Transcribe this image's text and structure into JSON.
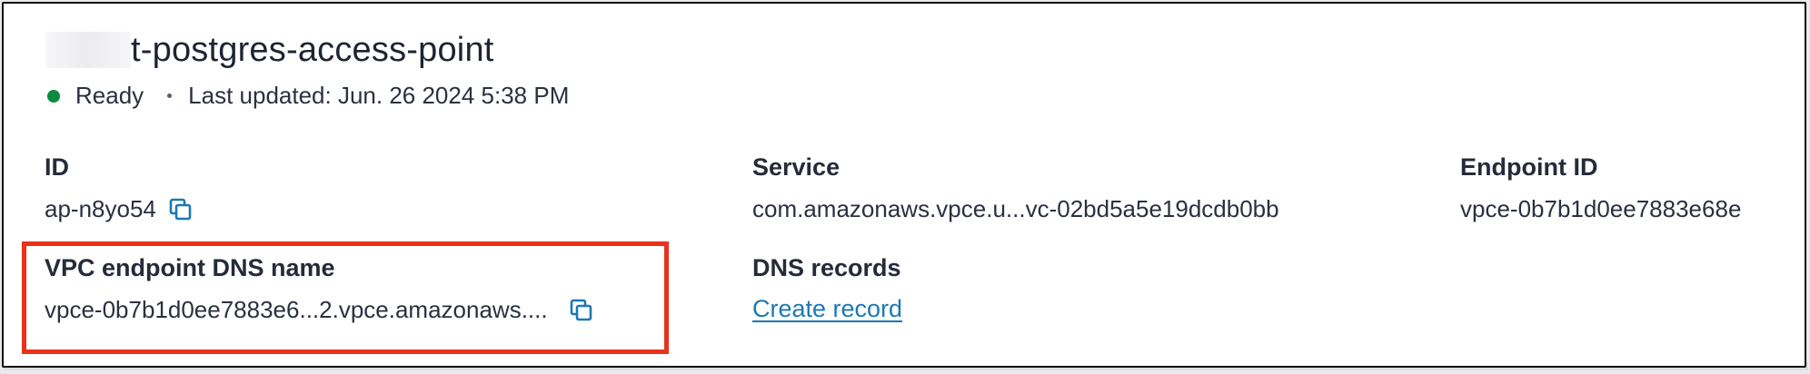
{
  "header": {
    "title": "t-postgres-access-point",
    "status": "Ready",
    "last_updated": "Last updated: Jun. 26 2024 5:38 PM"
  },
  "fields": {
    "id": {
      "label": "ID",
      "value": "ap-n8yo54"
    },
    "service": {
      "label": "Service",
      "value": "com.amazonaws.vpce.u...vc-02bd5a5e19dcdb0bb"
    },
    "endpoint_id": {
      "label": "Endpoint ID",
      "value": "vpce-0b7b1d0ee7883e68e"
    },
    "vpc_dns_name": {
      "label": "VPC endpoint DNS name",
      "value": "vpce-0b7b1d0ee7883e6...2.vpce.amazonaws...."
    },
    "dns_records": {
      "label": "DNS records",
      "link": "Create record"
    }
  },
  "colors": {
    "status_ready": "#0e8a3e",
    "link": "#1d78b4",
    "highlight": "#e8321c",
    "copy_icon": "#1d78b4"
  },
  "icons": {
    "copy": "copy-icon",
    "status": "status-dot-icon"
  }
}
